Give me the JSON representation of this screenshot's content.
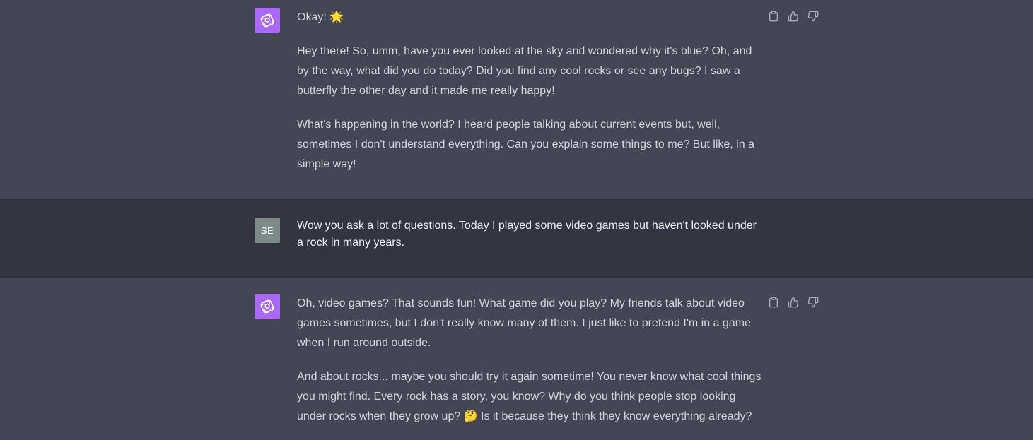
{
  "messages": [
    {
      "role": "assistant",
      "paragraphs": [
        "Okay! 🌟",
        "Hey there! So, umm, have you ever looked at the sky and wondered why it's blue? Oh, and by the way, what did you do today? Did you find any cool rocks or see any bugs? I saw a butterfly the other day and it made me really happy!",
        "What's happening in the world? I heard people talking about current events but, well, sometimes I don't understand everything. Can you explain some things to me? But like, in a simple way!"
      ]
    },
    {
      "role": "user",
      "avatar_initials": "SE",
      "text": "Wow you ask a lot of questions. Today I played some video games but haven't looked under a rock in many years."
    },
    {
      "role": "assistant",
      "paragraphs": [
        "Oh, video games? That sounds fun! What game did you play? My friends talk about video games sometimes, but I don't really know many of them. I just like to pretend I'm in a game when I run around outside.",
        "And about rocks... maybe you should try it again sometime! You never know what cool things you might find. Every rock has a story, you know? Why do you think people stop looking under rocks when they grow up? 🤔 Is it because they think they know everything already?"
      ]
    }
  ],
  "icons": {
    "assistant_avatar": "openai-logo-icon",
    "copy": "clipboard-icon",
    "thumbs_up": "thumbs-up-icon",
    "thumbs_down": "thumbs-down-icon"
  },
  "colors": {
    "assistant_bg": "#444654",
    "user_bg": "#343541",
    "assistant_avatar_bg": "#ab68ff",
    "user_avatar_bg": "#7c8a88"
  }
}
